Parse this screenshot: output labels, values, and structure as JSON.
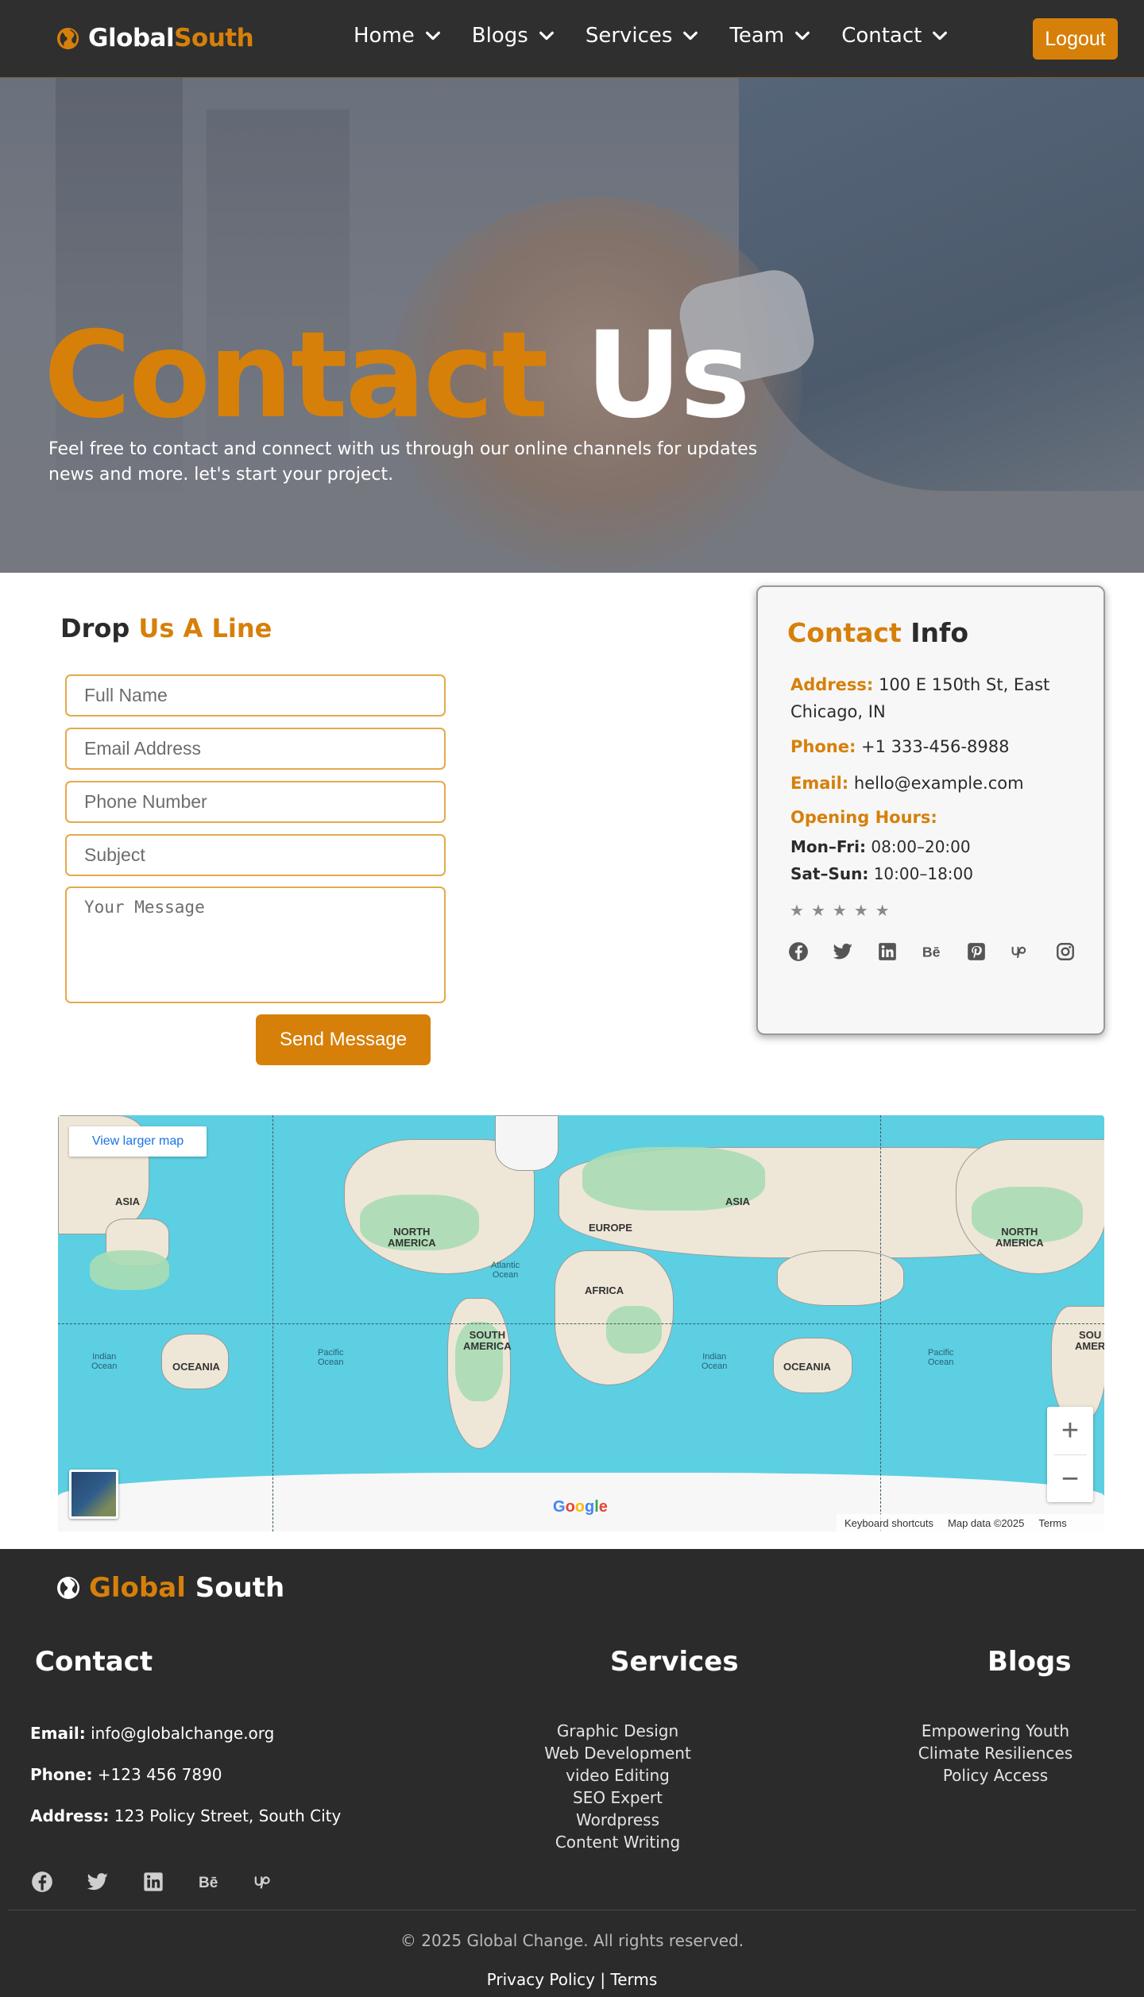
{
  "nav": {
    "brand_part1": "Global",
    "brand_part2": "South",
    "items": [
      {
        "label": "Home"
      },
      {
        "label": "Blogs"
      },
      {
        "label": "Services"
      },
      {
        "label": "Team"
      },
      {
        "label": "Contact"
      }
    ],
    "logout_label": "Logout"
  },
  "hero": {
    "title_part1": "Contact",
    "title_part2": "Us",
    "description": "Feel free to contact and connect with us through our online channels for updates news and more. let's start your project."
  },
  "form": {
    "title_part1": "Drop",
    "title_part2": "Us A Line",
    "fields": {
      "full_name": "Full Name",
      "email": "Email Address",
      "phone": "Phone Number",
      "subject": "Subject",
      "message": "Your Message"
    },
    "submit_label": "Send Message"
  },
  "contact_info": {
    "title_part1": "Contact",
    "title_part2": "Info",
    "address_label": "Address:",
    "address_value": "100 E 150th St, East Chicago, IN",
    "phone_label": "Phone:",
    "phone_value": "+1 333-456-8988",
    "email_label": "Email:",
    "email_value": "hello@example.com",
    "hours_label": "Opening Hours:",
    "weekday_label": "Mon–Fri:",
    "weekday_value": "08:00–20:00",
    "weekend_label": "Sat–Sun:",
    "weekend_value": "10:00–18:00",
    "rating_stars": 5,
    "social_icons": [
      "facebook-icon",
      "twitter-icon",
      "linkedin-icon",
      "behance-icon",
      "pinterest-icon",
      "upwork-icon",
      "instagram-icon"
    ]
  },
  "map": {
    "larger_map_label": "View larger map",
    "labels": {
      "asia_left": "ASIA",
      "north_america_left": "NORTH\nAMERICA",
      "atlantic": "Atlantic\nOcean",
      "europe": "EUROPE",
      "asia_right": "ASIA",
      "north_america_right": "NORTH\nAMERICA",
      "africa": "AFRICA",
      "south_america": "SOUTH\nAMERICA",
      "south_america_right": "SOU\nAMER",
      "indian_left": "Indian\nOcean",
      "oceania_left": "OCEANIA",
      "pacific_left": "Pacific\nOcean",
      "indian_right": "Indian\nOcean",
      "oceania_right": "OCEANIA",
      "pacific_right": "Pacific\nOcean"
    },
    "google_logo": "Google",
    "zoom_in": "+",
    "zoom_out": "−",
    "keyboard_shortcuts": "Keyboard shortcuts",
    "map_data": "Map data ©2025",
    "terms": "Terms"
  },
  "footer": {
    "brand_part1": "Global",
    "brand_part2": "South",
    "contact_heading": "Contact",
    "services_heading": "Services",
    "blogs_heading": "Blogs",
    "email_label": "Email:",
    "email_value": "info@globalchange.org",
    "phone_label": "Phone:",
    "phone_value": "+123 456 7890",
    "address_label": "Address:",
    "address_value": "123 Policy Street, South City",
    "services": [
      "Graphic Design",
      "Web Development",
      "video Editing",
      "SEO Expert",
      "Wordpress",
      "Content Writing"
    ],
    "blogs": [
      "Empowering Youth",
      "Climate Resiliences",
      "Policy Access"
    ],
    "social_icons": [
      "facebook-icon",
      "twitter-icon",
      "linkedin-icon",
      "behance-icon",
      "upwork-icon"
    ],
    "copyright": "© 2025 Global Change. All rights reserved.",
    "privacy": "Privacy Policy",
    "separator": "|",
    "terms": "Terms"
  },
  "colors": {
    "accent": "#d6800a",
    "navbar_bg": "#2f2f2f",
    "footer_bg": "#2b2b2b",
    "map_water": "#5ccfe2"
  }
}
